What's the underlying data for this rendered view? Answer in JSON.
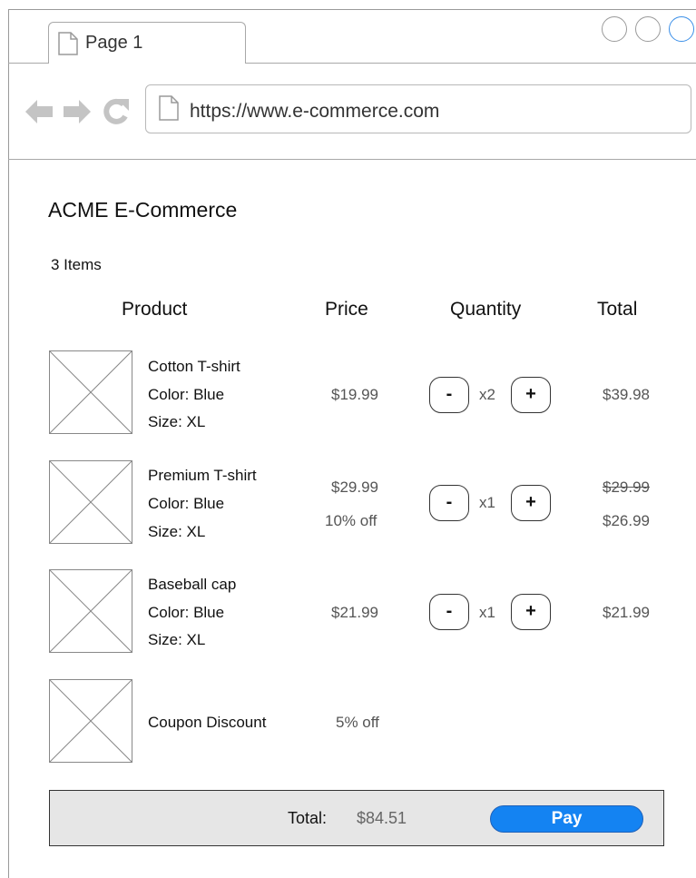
{
  "browser": {
    "tab_title": "Page 1",
    "url": "https://www.e-commerce.com",
    "window_buttons": [
      "minimize",
      "maximize",
      "close"
    ],
    "accent_color": "#3b8fe8"
  },
  "page": {
    "title": "ACME E-Commerce",
    "item_count": "3 Items",
    "columns": {
      "product": "Product",
      "price": "Price",
      "quantity": "Quantity",
      "total": "Total"
    }
  },
  "cart": {
    "items": [
      {
        "name": "Cotton T-shirt",
        "color": "Color: Blue",
        "size": "Size: XL",
        "price": "$19.99",
        "quantity": "x2",
        "total": "$39.98"
      },
      {
        "name": "Premium T-shirt",
        "color": "Color: Blue",
        "size": "Size: XL",
        "price": "$29.99",
        "discount": "10% off",
        "quantity": "x1",
        "original_total": "$29.99",
        "total": "$26.99"
      },
      {
        "name": "Baseball cap",
        "color": "Color: Blue",
        "size": "Size: XL",
        "price": "$21.99",
        "quantity": "x1",
        "total": "$21.99"
      }
    ],
    "coupon": {
      "name": "Coupon Discount",
      "discount": "5% off"
    },
    "decrement_label": "-",
    "increment_label": "+"
  },
  "footer": {
    "total_label": "Total:",
    "total_value": "$84.51",
    "pay_label": "Pay",
    "pay_color": "#1483f2"
  }
}
